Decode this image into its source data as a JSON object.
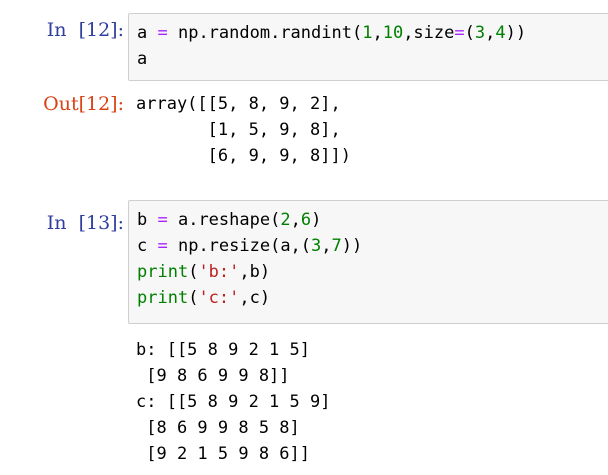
{
  "cells": [
    {
      "in_prompt": "In  [12]:",
      "input_lines": [
        "a = np.random.randint(1,10,size=(3,4))",
        "a"
      ],
      "out_prompt": "Out[12]:",
      "output_lines": [
        "array([[5, 8, 9, 2],",
        "       [1, 5, 9, 8],",
        "       [6, 9, 9, 8]])"
      ]
    },
    {
      "in_prompt": "In  [13]:",
      "input_lines": [
        "b = a.reshape(2,6)",
        "c = np.resize(a,(3,7))",
        "print('b:',b)",
        "print('c:',c)"
      ],
      "output_lines": [
        "b: [[5 8 9 2 1 5]",
        " [9 8 6 9 9 8]]",
        "c: [[5 8 9 2 1 5 9]",
        " [8 6 9 9 8 5 8]",
        " [9 2 1 5 9 8 6]]"
      ]
    }
  ],
  "colors": {
    "in_prompt": "#303f9f",
    "out_prompt": "#d84315",
    "input_background": "#f7f7f7",
    "input_border": "#cfcfcf"
  }
}
